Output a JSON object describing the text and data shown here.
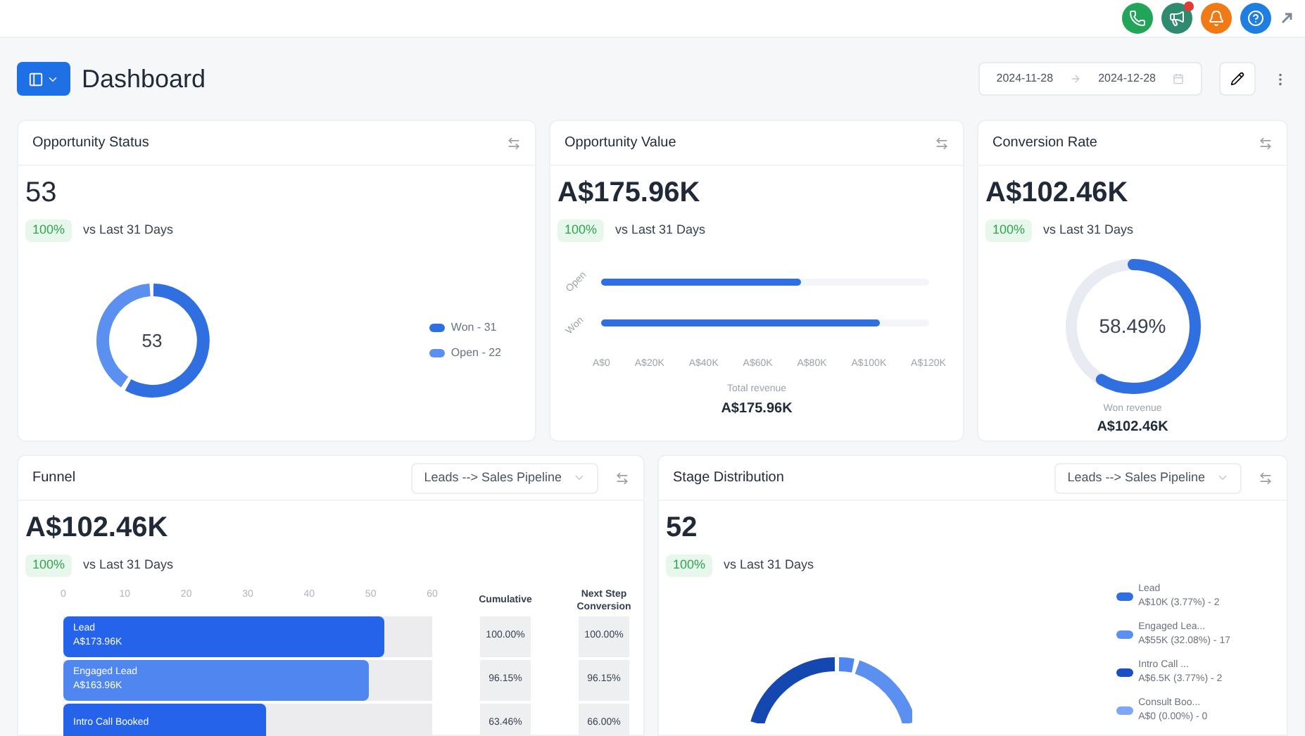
{
  "header": {
    "title": "Dashboard",
    "date_from": "2024-11-28",
    "date_to": "2024-12-28"
  },
  "top_icons": [
    {
      "kind": "phone",
      "color": "#22a559",
      "badge": false
    },
    {
      "kind": "megaphone",
      "color": "#2e8b6e",
      "badge": true
    },
    {
      "kind": "bell",
      "color": "#f07b16",
      "badge": false
    },
    {
      "kind": "help",
      "color": "#1f7fe0",
      "badge": false
    }
  ],
  "opportunity_status": {
    "title": "Opportunity Status",
    "value": "53",
    "change": "100%",
    "compare": "vs Last 31 Days",
    "center": "53",
    "legend": [
      {
        "label": "Won - 31",
        "color": "#2f6fe0"
      },
      {
        "label": "Open - 22",
        "color": "#5b8ff0"
      }
    ]
  },
  "opportunity_value": {
    "title": "Opportunity Value",
    "value": "A$175.96K",
    "change": "100%",
    "compare": "vs Last 31 Days",
    "bars": [
      {
        "label": "Open",
        "level": 0.61
      },
      {
        "label": "Won",
        "level": 0.85
      }
    ],
    "axis_labels": [
      "A$0",
      "A$20K",
      "A$40K",
      "A$60K",
      "A$80K",
      "A$100K",
      "A$120K"
    ],
    "footer_label": "Total revenue",
    "footer_value": "A$175.96K"
  },
  "conversion_rate": {
    "title": "Conversion Rate",
    "value": "A$102.46K",
    "change": "100%",
    "compare": "vs Last 31 Days",
    "level": 0.5849,
    "reading": "58.49%",
    "footer_label": "Won revenue",
    "footer_value": "A$102.46K"
  },
  "funnel": {
    "title": "Funnel",
    "pipeline": "Leads --> Sales Pipeline",
    "value": "A$102.46K",
    "change": "100%",
    "compare": "vs Last 31 Days",
    "axis_labels": [
      "0",
      "10",
      "20",
      "30",
      "40",
      "50",
      "60"
    ],
    "columns": [
      "Cumulative",
      "Next Step Conversion"
    ],
    "rows": [
      {
        "label": "Lead",
        "amount": "A$173.96K",
        "level": 0.87,
        "color": "#2563eb",
        "cumulative": "100.00%",
        "next": "100.00%"
      },
      {
        "label": "Engaged Lead",
        "amount": "A$163.96K",
        "level": 0.83,
        "color": "#4f86ef",
        "cumulative": "96.15%",
        "next": "96.15%"
      },
      {
        "label": "Intro Call Booked",
        "level": 0.55,
        "color": "#2563eb",
        "cumulative": "63.46%",
        "next": "66.00%"
      }
    ]
  },
  "stage_distribution": {
    "title": "Stage Distribution",
    "pipeline": "Leads --> Sales Pipeline",
    "value": "52",
    "change": "100%",
    "compare": "vs Last 31 Days",
    "legend": [
      {
        "name": "Lead",
        "detail": "A$10K (3.77%) - 2",
        "color": "#2f6fe0"
      },
      {
        "name": "Engaged Lea...",
        "detail": "A$55K (32.08%) - 17",
        "color": "#5b8ff0"
      },
      {
        "name": "Intro Call ...",
        "detail": "A$6.5K (3.77%) - 2",
        "color": "#1d4fc4"
      },
      {
        "name": "Consult Boo...",
        "detail": "A$0 (0.00%) - 0",
        "color": "#7ea8f5"
      }
    ]
  }
}
